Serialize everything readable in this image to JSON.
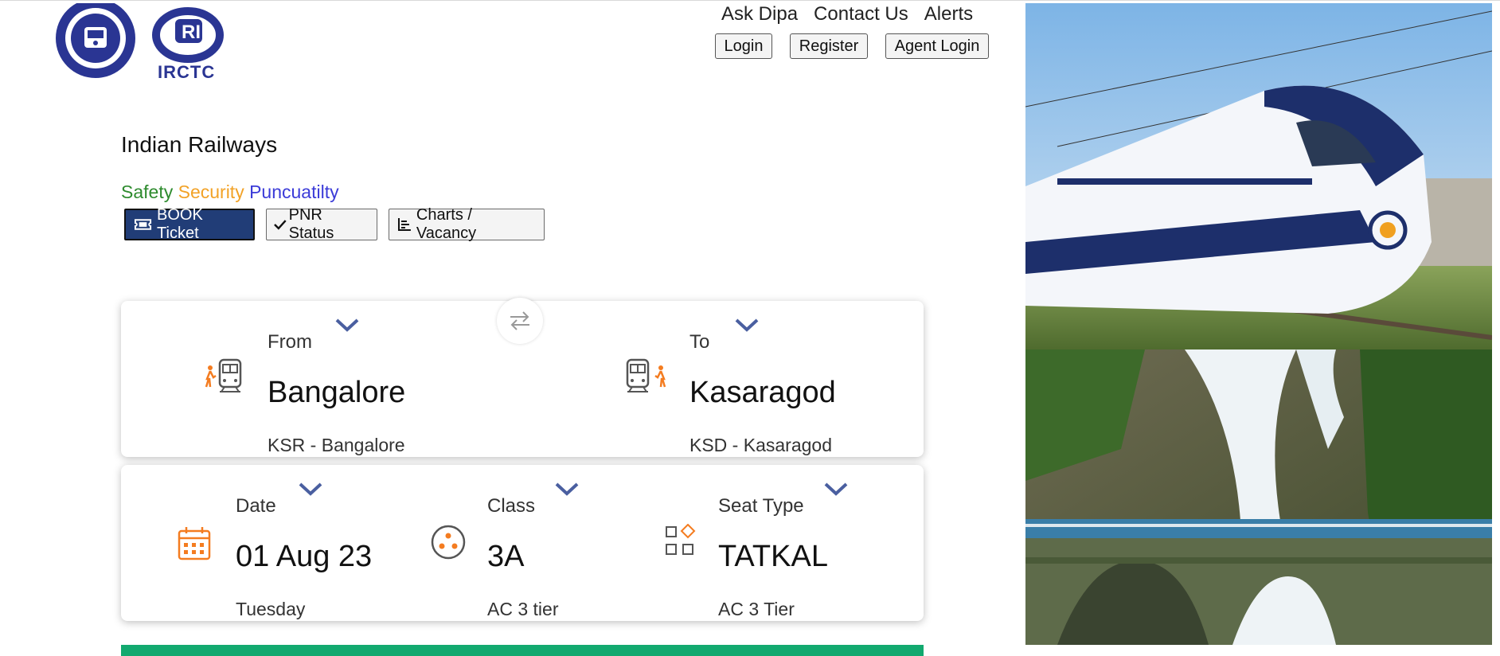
{
  "header": {
    "logo_text": "IRCTC",
    "top_links": [
      "Ask Dipa",
      "Contact Us",
      "Alerts"
    ],
    "buttons": {
      "login": "Login",
      "register": "Register",
      "agent_login": "Agent Login"
    }
  },
  "brand": {
    "title": "Indian Railways",
    "tagline": {
      "safety": "Safety",
      "security": "Security",
      "punctuality": "Puncuatilty"
    }
  },
  "modes": {
    "book": "BOOK Ticket",
    "pnr": "PNR Status",
    "charts": "Charts / Vacancy"
  },
  "journey": {
    "from": {
      "label": "From",
      "city": "Bangalore",
      "station": "KSR - Bangalore"
    },
    "to": {
      "label": "To",
      "city": "Kasaragod",
      "station": "KSD - Kasaragod"
    }
  },
  "details": {
    "date": {
      "label": "Date",
      "value": "01 Aug 23",
      "sub": "Tuesday"
    },
    "class": {
      "label": "Class",
      "value": "3A",
      "sub": "AC 3 tier"
    },
    "seat": {
      "label": "Seat Type",
      "value": "TATKAL",
      "sub": "AC 3 Tier"
    }
  },
  "colors": {
    "primary": "#213d77",
    "accent_orange": "#f47c20",
    "chevron": "#4a5fa0",
    "search_bar": "#12a96f"
  },
  "icons": [
    "ticket-icon",
    "check-icon",
    "chart-icon",
    "swap-icon",
    "train-icon",
    "calendar-icon",
    "class-icon",
    "seat-type-icon",
    "chevron-down-icon"
  ]
}
